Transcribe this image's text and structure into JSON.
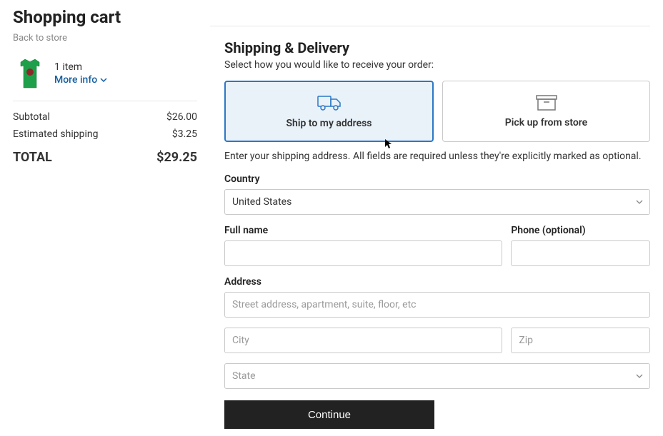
{
  "cart": {
    "title": "Shopping cart",
    "back_link": "Back to store",
    "item_count": "1 item",
    "more_info": "More info",
    "subtotal_label": "Subtotal",
    "subtotal_value": "$26.00",
    "shipping_label": "Estimated shipping",
    "shipping_value": "$3.25",
    "total_label": "TOTAL",
    "total_value": "$29.25"
  },
  "shipping": {
    "title": "Shipping & Delivery",
    "subtitle": "Select how you would like to receive your order:",
    "option_ship": "Ship to my address",
    "option_pickup": "Pick up from store",
    "desc": "Enter your shipping address. All fields are required unless they're explicitly marked as optional."
  },
  "form": {
    "country_label": "Country",
    "country_value": "United States",
    "fullname_label": "Full name",
    "fullname_value": "",
    "phone_label": "Phone (optional)",
    "phone_value": "",
    "address_label": "Address",
    "street_placeholder": "Street address, apartment, suite, floor, etc",
    "street_value": "",
    "city_placeholder": "City",
    "city_value": "",
    "zip_placeholder": "Zip",
    "zip_value": "",
    "state_placeholder": "State",
    "continue_label": "Continue"
  }
}
